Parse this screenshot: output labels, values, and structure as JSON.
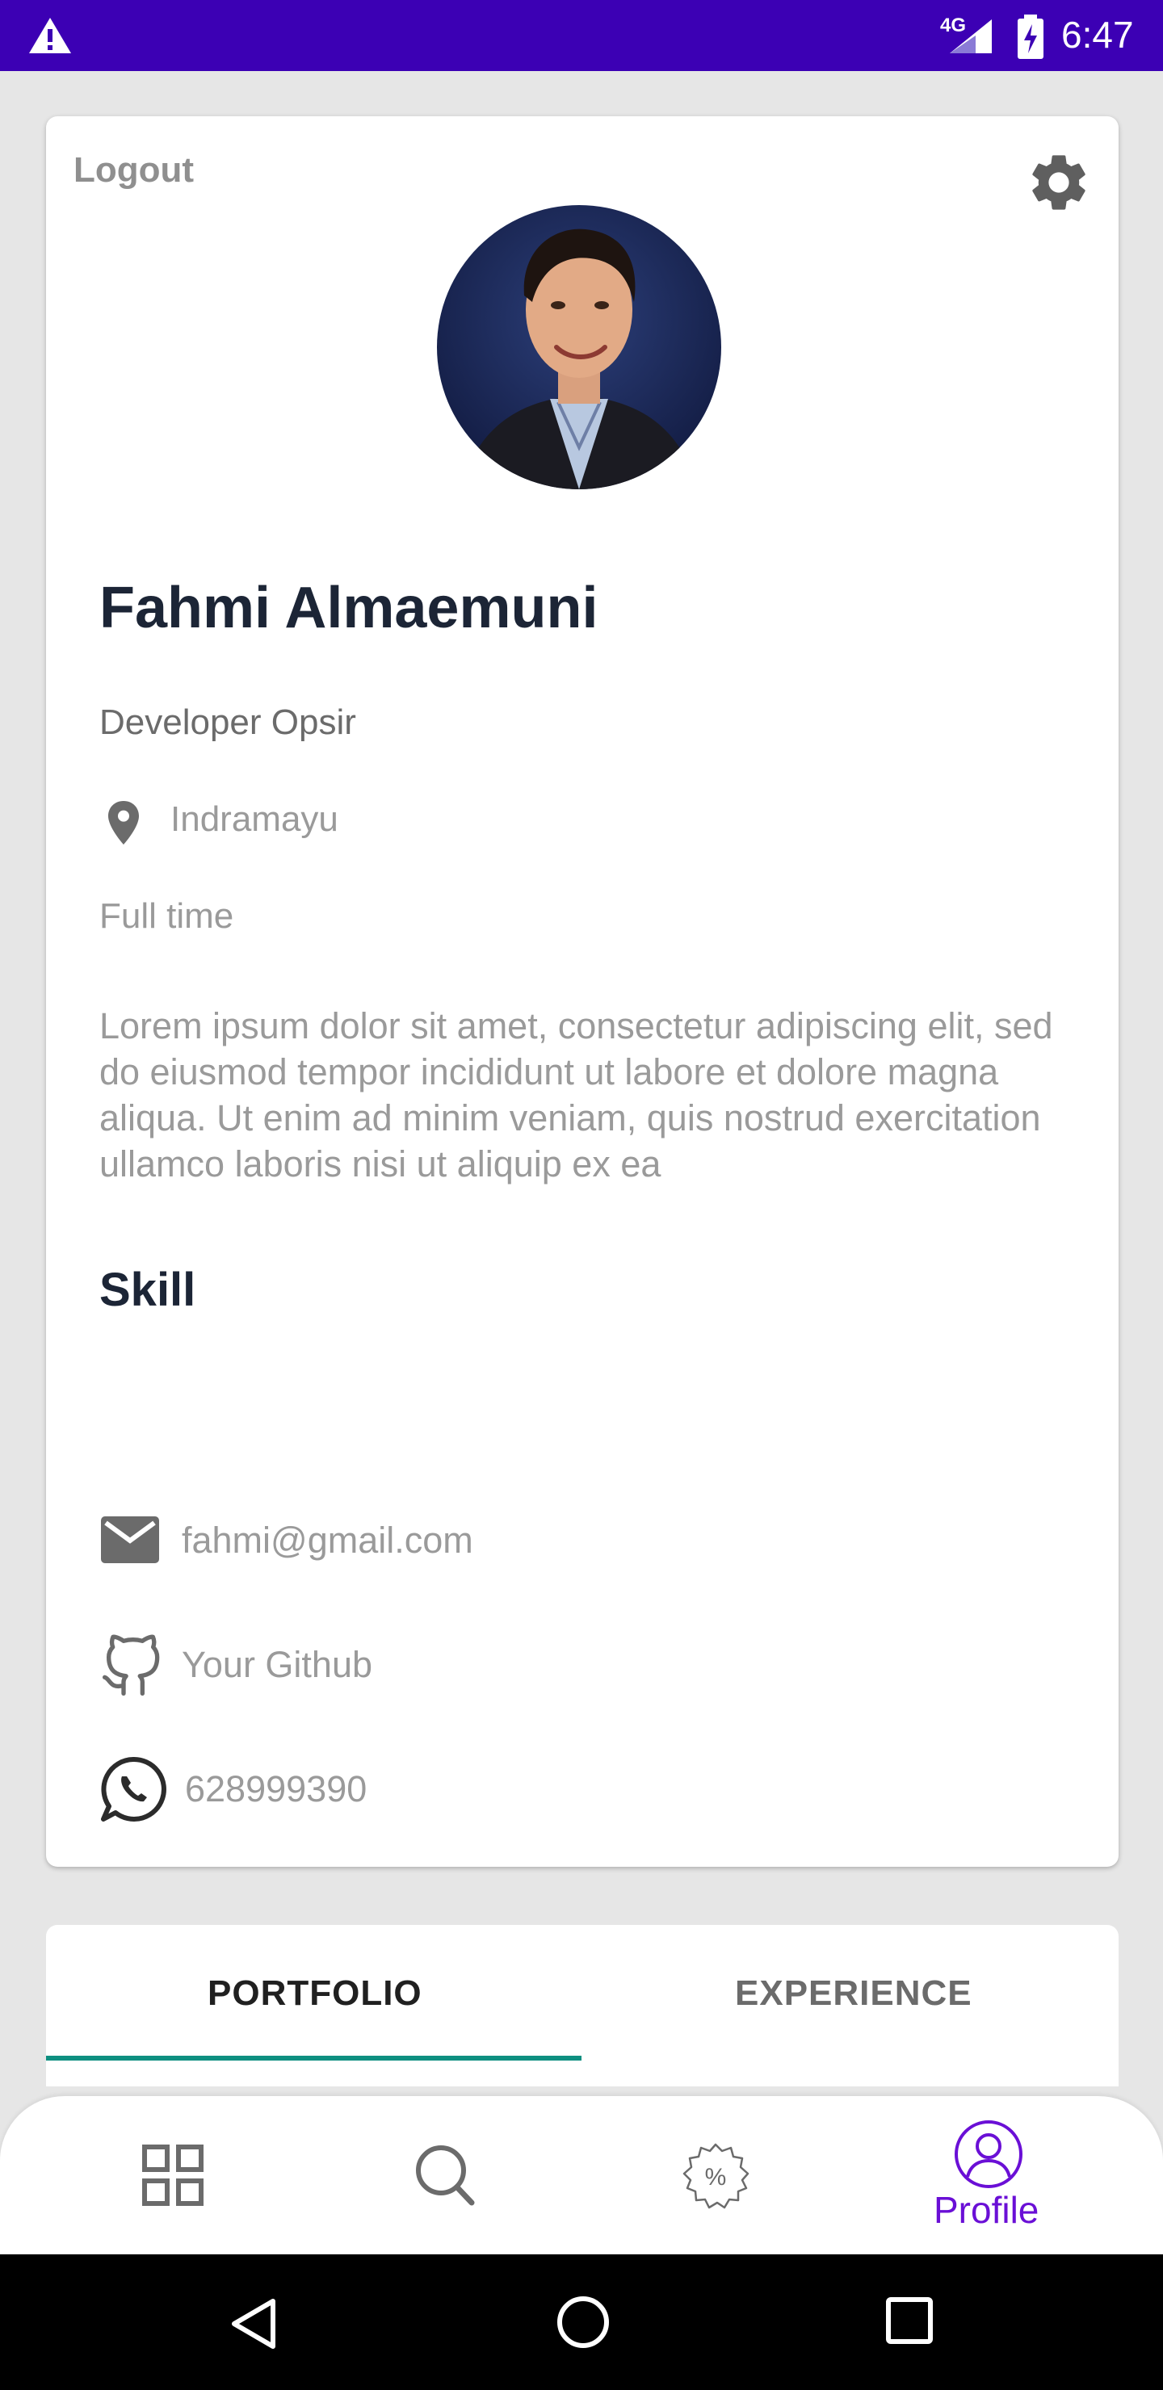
{
  "status_bar": {
    "network": "4G",
    "time": "6:47",
    "icons": [
      "warning-icon",
      "signal-icon",
      "battery-charging-icon"
    ]
  },
  "profile": {
    "logout_label": "Logout",
    "name": "Fahmi Almaemuni",
    "role": "Developer Opsir",
    "location": "Indramayu",
    "job_type": "Full time",
    "bio": "Lorem ipsum dolor sit amet, consectetur adipiscing elit, sed do eiusmod tempor incididunt ut labore et dolore magna aliqua. Ut enim ad minim veniam, quis nostrud exercitation ullamco laboris nisi ut aliquip ex ea",
    "skill_heading": "Skill",
    "email": "fahmi@gmail.com",
    "github": "Your Github",
    "phone": "628999390"
  },
  "tabs": [
    {
      "label": "PORTFOLIO",
      "active": true
    },
    {
      "label": "EXPERIENCE",
      "active": false
    }
  ],
  "bottom_nav": {
    "items": [
      "grid-icon",
      "search-icon",
      "discount-icon",
      "profile-icon"
    ],
    "active_label": "Profile"
  },
  "colors": {
    "status_bar": "#3c00b4",
    "accent": "#6a0fd6",
    "tab_indicator": "#0e8f80",
    "heading": "#1c2536",
    "muted": "#9a9a9a"
  }
}
